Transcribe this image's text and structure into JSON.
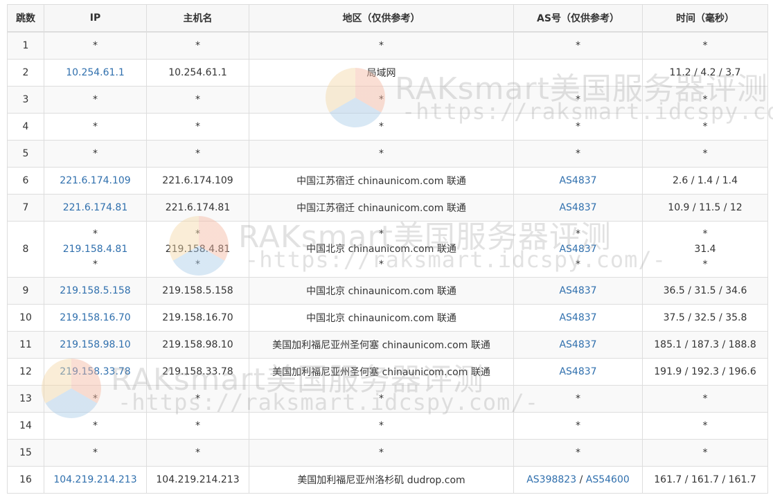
{
  "headers": [
    "跳数",
    "IP",
    "主机名",
    "地区（仅供参考）",
    "AS号（仅供参考）",
    "时间（毫秒）"
  ],
  "watermark": {
    "line1": "RAKsmart美国服务器评测",
    "line2": "-https://raksmart.idcspy.com/-"
  },
  "rows": [
    {
      "hop": "1",
      "ip": "*",
      "host": "*",
      "region": "*",
      "as": "*",
      "time": "*"
    },
    {
      "hop": "2",
      "ip": "10.254.61.1",
      "host": "10.254.61.1",
      "region": "局域网",
      "as": "",
      "time": "11.2 / 4.2 / 3.7"
    },
    {
      "hop": "3",
      "ip": "*",
      "host": "*",
      "region": "*",
      "as": "*",
      "time": "*"
    },
    {
      "hop": "4",
      "ip": "*",
      "host": "*",
      "region": "*",
      "as": "*",
      "time": "*"
    },
    {
      "hop": "5",
      "ip": "*",
      "host": "*",
      "region": "*",
      "as": "*",
      "time": "*"
    },
    {
      "hop": "6",
      "ip": "221.6.174.109",
      "host": "221.6.174.109",
      "region": "中国江苏宿迁 chinaunicom.com 联通",
      "as": "AS4837",
      "time": "2.6 / 1.4 / 1.4"
    },
    {
      "hop": "7",
      "ip": "221.6.174.81",
      "host": "221.6.174.81",
      "region": "中国江苏宿迁 chinaunicom.com 联通",
      "as": "AS4837",
      "time": "10.9 / 11.5 / 12"
    },
    {
      "hop": "8",
      "ip": [
        "*",
        "219.158.4.81",
        "*"
      ],
      "host": [
        "*",
        "219.158.4.81",
        "*"
      ],
      "region": [
        "*",
        "中国北京 chinaunicom.com 联通",
        "*"
      ],
      "as": [
        "*",
        "AS4837",
        "*"
      ],
      "time": [
        "*",
        "31.4",
        "*"
      ]
    },
    {
      "hop": "9",
      "ip": "219.158.5.158",
      "host": "219.158.5.158",
      "region": "中国北京 chinaunicom.com 联通",
      "as": "AS4837",
      "time": "36.5 / 31.5 / 34.6"
    },
    {
      "hop": "10",
      "ip": "219.158.16.70",
      "host": "219.158.16.70",
      "region": "中国北京 chinaunicom.com 联通",
      "as": "AS4837",
      "time": "37.5 / 32.5 / 35.8"
    },
    {
      "hop": "11",
      "ip": "219.158.98.10",
      "host": "219.158.98.10",
      "region": "美国加利福尼亚州圣何塞 chinaunicom.com 联通",
      "as": "AS4837",
      "time": "185.1 / 187.3 / 188.8"
    },
    {
      "hop": "12",
      "ip": "219.158.33.78",
      "host": "219.158.33.78",
      "region": "美国加利福尼亚州圣何塞 chinaunicom.com 联通",
      "as": "AS4837",
      "time": "191.9 / 192.3 / 196.6"
    },
    {
      "hop": "13",
      "ip": "*",
      "host": "*",
      "region": "*",
      "as": "*",
      "time": "*"
    },
    {
      "hop": "14",
      "ip": "*",
      "host": "*",
      "region": "*",
      "as": "*",
      "time": "*"
    },
    {
      "hop": "15",
      "ip": "*",
      "host": "*",
      "region": "*",
      "as": "*",
      "time": "*"
    },
    {
      "hop": "16",
      "ip": "104.219.214.213",
      "host": "104.219.214.213",
      "region": "美国加利福尼亚州洛杉矶 dudrop.com",
      "as": [
        "AS398823",
        "AS54600"
      ],
      "as_separator": " / ",
      "time": "161.7 / 161.7 / 161.7"
    }
  ]
}
